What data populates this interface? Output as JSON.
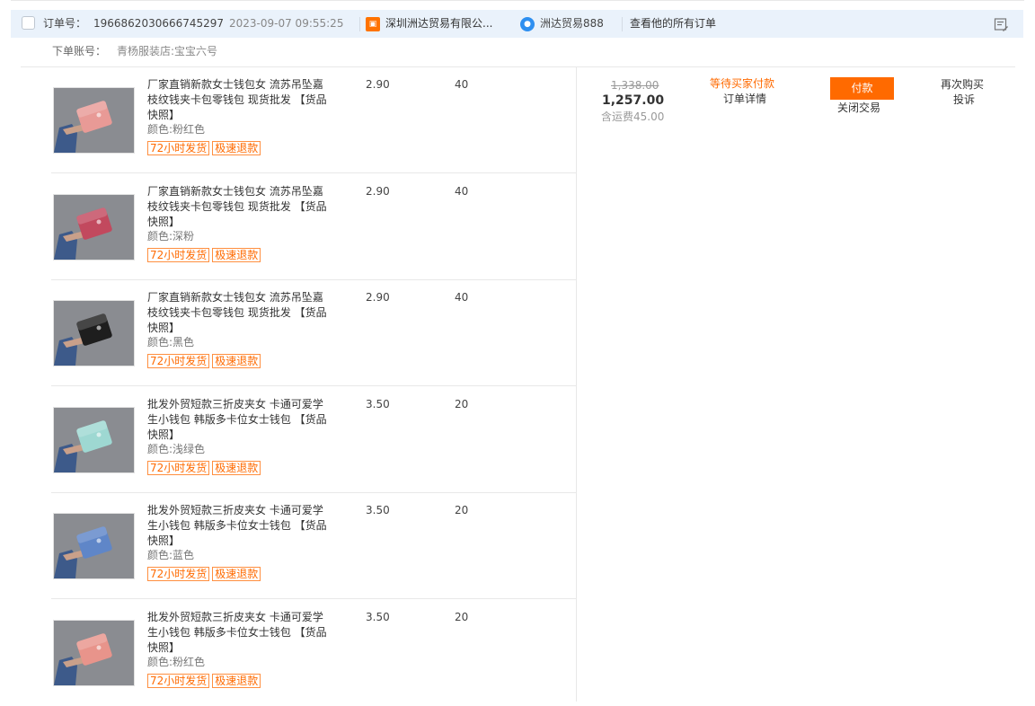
{
  "order": {
    "checkbox_checked": false,
    "number_label": "订单号：",
    "number": "1966862030666745297",
    "time": "2023-09-07 09:55:25",
    "shop_icon": "shop-icon",
    "shop_name": "深圳洲达贸易有限公...",
    "chat_icon": "wangwang-chat-icon",
    "wangwang_name": "洲达贸易888",
    "view_all": "查看他的所有订单",
    "memo_icon": "memo-icon"
  },
  "buyer": {
    "label": "下单账号：",
    "value": "青杨服装店:宝宝六号"
  },
  "items": [
    {
      "title": "厂家直销新款女士钱包女 流苏吊坠嘉枝纹钱夹卡包零钱包 现货批发 【货品快照】",
      "color": "颜色:粉红色",
      "tags": [
        "72小时发货",
        "极速退款"
      ],
      "price": "2.90",
      "qty": "40",
      "swatch": "#e89a96",
      "thumb_icon": "pink-wallet-image"
    },
    {
      "title": "厂家直销新款女士钱包女 流苏吊坠嘉枝纹钱夹卡包零钱包 现货批发 【货品快照】",
      "color": "颜色:深粉",
      "tags": [
        "72小时发货",
        "极速退款"
      ],
      "price": "2.90",
      "qty": "40",
      "swatch": "#c2495e",
      "thumb_icon": "dark-pink-wallet-image"
    },
    {
      "title": "厂家直销新款女士钱包女 流苏吊坠嘉枝纹钱夹卡包零钱包 现货批发 【货品快照】",
      "color": "颜色:黑色",
      "tags": [
        "72小时发货",
        "极速退款"
      ],
      "price": "2.90",
      "qty": "40",
      "swatch": "#1e1e1e",
      "thumb_icon": "black-wallet-image"
    },
    {
      "title": "批发外贸短款三折皮夹女 卡通可爱学生小钱包 韩版多卡位女士钱包 【货品快照】",
      "color": "颜色:浅绿色",
      "tags": [
        "72小时发货",
        "极速退款"
      ],
      "price": "3.50",
      "qty": "20",
      "swatch": "#9ed8d2",
      "thumb_icon": "light-green-wallet-image"
    },
    {
      "title": "批发外贸短款三折皮夹女 卡通可爱学生小钱包 韩版多卡位女士钱包 【货品快照】",
      "color": "颜色:蓝色",
      "tags": [
        "72小时发货",
        "极速退款"
      ],
      "price": "3.50",
      "qty": "20",
      "swatch": "#5f86c8",
      "thumb_icon": "blue-wallet-image"
    },
    {
      "title": "批发外贸短款三折皮夹女 卡通可爱学生小钱包 韩版多卡位女士钱包 【货品快照】",
      "color": "颜色:粉红色",
      "tags": [
        "72小时发货",
        "极速退款"
      ],
      "price": "3.50",
      "qty": "20",
      "swatch": "#e8948b",
      "thumb_icon": "pink-wallet-image"
    }
  ],
  "summary": {
    "original_total": "1,338.00",
    "total": "1,257.00",
    "shipping": "含运费45.00",
    "status": "等待买家付款",
    "detail_link": "订单详情",
    "pay_button": "付款",
    "close_link": "关闭交易",
    "rebuy_link": "再次购买",
    "complain_link": "投诉"
  },
  "colors": {
    "accent": "#ff6a00",
    "header_bg": "#eaf2fb",
    "link_blue": "#2e8ff0"
  }
}
